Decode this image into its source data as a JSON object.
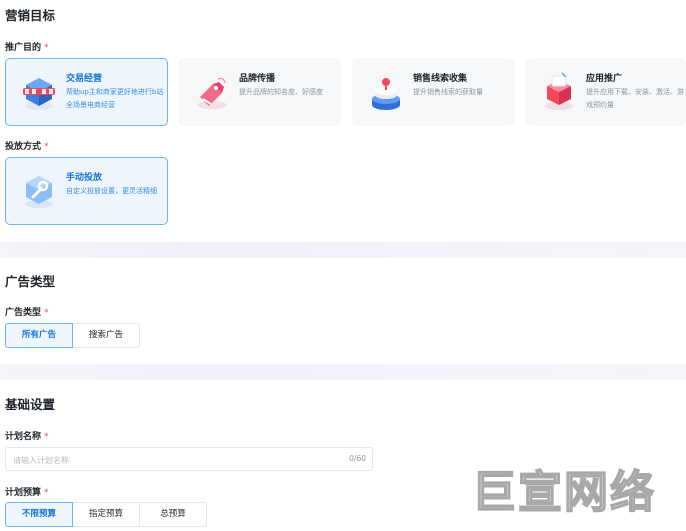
{
  "marketing_goal": {
    "title": "营销目标",
    "promotion_purpose_label": "推广目的",
    "required_mark": "*",
    "goal_cards": [
      {
        "title": "交易经营",
        "desc": "帮助up主和商家更好地进行b站全场景电商经营",
        "icon": "shopping-cube-icon"
      },
      {
        "title": "品牌传播",
        "desc": "提升品牌的知名度、好感度",
        "icon": "brand-tag-icon"
      },
      {
        "title": "销售线索收集",
        "desc": "提升销售线索的获取量",
        "icon": "leads-stack-icon"
      },
      {
        "title": "应用推广",
        "desc": "提升应用下载、安装、激活、游戏预约量",
        "icon": "app-cube-icon"
      }
    ],
    "delivery_method_label": "投放方式",
    "delivery_cards": [
      {
        "title": "手动投放",
        "desc": "自定义投放设置，更灵活精细",
        "icon": "wrench-icon"
      }
    ]
  },
  "ad_type": {
    "title": "广告类型",
    "label": "广告类型",
    "options": [
      "所有广告",
      "搜索广告"
    ],
    "selected": "所有广告"
  },
  "basic_settings": {
    "title": "基础设置",
    "plan_name_label": "计划名称",
    "plan_name_placeholder": "请输入计划名称",
    "plan_name_value": "",
    "plan_name_counter": "0/60",
    "budget_label": "计划预算",
    "budget_options": [
      "不限预算",
      "指定预算",
      "总预算"
    ],
    "budget_selected": "不限预算"
  },
  "watermark": "巨宣网络",
  "colors": {
    "accent": "#1475d6",
    "selected_border": "#6fb4f2",
    "selected_bg": "#eef5fd",
    "required": "#f5475a"
  }
}
